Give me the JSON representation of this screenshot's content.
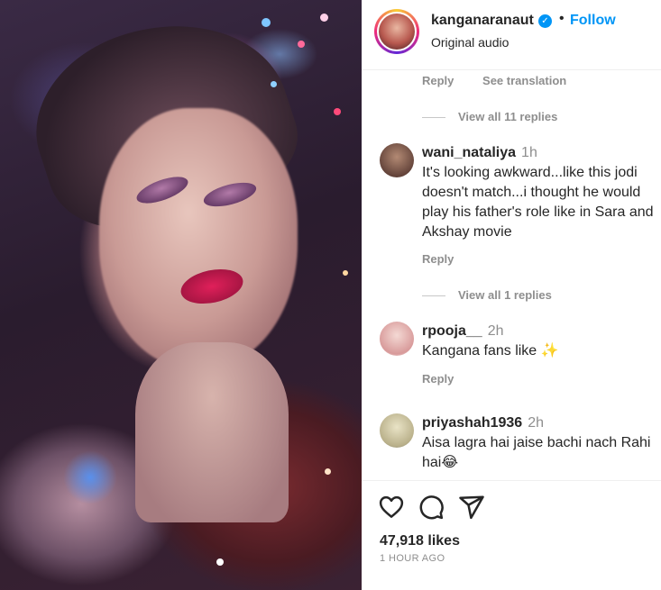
{
  "post": {
    "username": "kanganaranaut",
    "verified_mark": "✓",
    "separator": "•",
    "follow_label": "Follow",
    "audio_label": "Original audio",
    "media_icon": "photo-of-woman"
  },
  "top_actions": {
    "reply_label": "Reply",
    "see_translation_label": "See translation",
    "view_replies_label": "View all 11 replies"
  },
  "comments": [
    {
      "username": "wani_nataliya",
      "time": "1h",
      "text": "It's looking awkward...like this jodi doesn't match...i thought he would play his father's role like in Sara and Akshay movie",
      "reply_label": "Reply",
      "view_replies_label": "View all 1 replies"
    },
    {
      "username": "rpooja__",
      "time": "2h",
      "text": "Kangana fans like ✨",
      "reply_label": "Reply"
    },
    {
      "username": "priyashah1936",
      "time": "2h",
      "text": "Aisa lagra hai jaise bachi nach Rahi hai😂"
    }
  ],
  "footer": {
    "likes": "47,918 likes",
    "timestamp": "1 HOUR AGO",
    "icons": [
      "heart-icon",
      "comment-icon",
      "share-icon"
    ]
  },
  "colors": {
    "accent": "#0095f6",
    "text": "#262626",
    "muted": "#8e8e8e",
    "border": "#efefef"
  }
}
